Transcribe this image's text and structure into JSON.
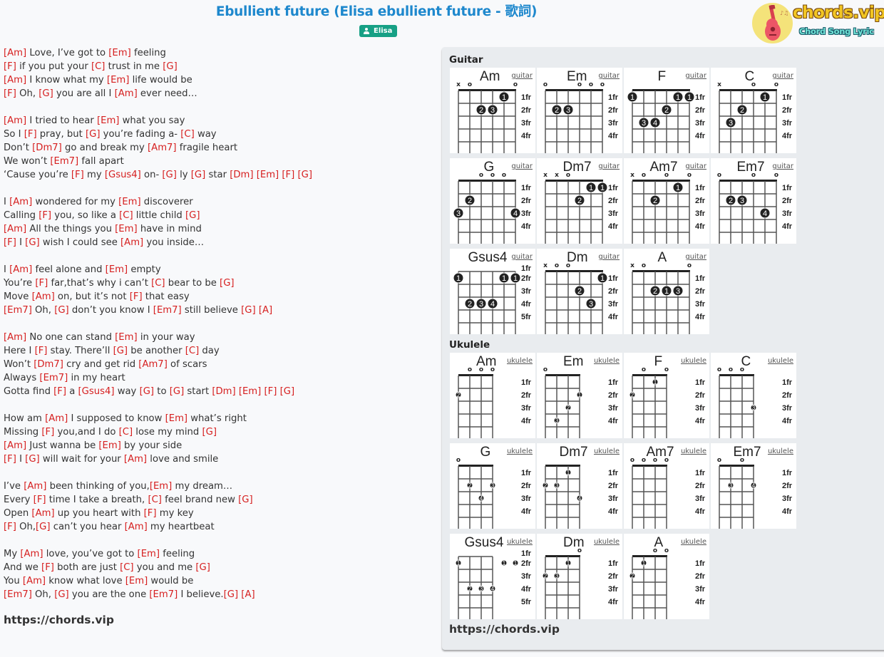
{
  "header": {
    "title": "Ebullient future (Elisa ebullient future - 歌詞)",
    "artist": "Elisa",
    "logo_text": "chords.vip",
    "logo_subtitle": "Chord Song Lyric"
  },
  "lyrics": [
    [
      [
        "Am",
        " Love, I’ve got to "
      ],
      [
        "Em",
        " feeling"
      ]
    ],
    [
      [
        "F",
        " if you put your "
      ],
      [
        "C",
        " trust in me "
      ],
      [
        "G",
        ""
      ]
    ],
    [
      [
        "Am",
        " I know what my "
      ],
      [
        "Em",
        " life would be"
      ]
    ],
    [
      [
        "F",
        " Oh, "
      ],
      [
        "G",
        " you are all I "
      ],
      [
        "Am",
        " ever need…"
      ]
    ],
    null,
    [
      [
        "Am",
        " I tried to hear "
      ],
      [
        "Em",
        " what you say"
      ]
    ],
    [
      [
        null,
        "So I "
      ],
      [
        "F",
        " pray, but "
      ],
      [
        "G",
        " you’re fading a- "
      ],
      [
        "C",
        " way"
      ]
    ],
    [
      [
        null,
        "Don’t "
      ],
      [
        "Dm7",
        " go and break my "
      ],
      [
        "Am7",
        " fragile heart"
      ]
    ],
    [
      [
        null,
        "We won’t "
      ],
      [
        "Em7",
        " fall apart"
      ]
    ],
    [
      [
        null,
        "‘Cause you’re "
      ],
      [
        "F",
        " my "
      ],
      [
        "Gsus4",
        " on- "
      ],
      [
        "G",
        " ly "
      ],
      [
        "G",
        " star "
      ],
      [
        "Dm",
        " "
      ],
      [
        "Em",
        " "
      ],
      [
        "F",
        " "
      ],
      [
        "G",
        ""
      ]
    ],
    null,
    [
      [
        null,
        "I "
      ],
      [
        "Am",
        " wondered for my "
      ],
      [
        "Em",
        " discoverer"
      ]
    ],
    [
      [
        null,
        "Calling "
      ],
      [
        "F",
        " you, so like a "
      ],
      [
        "C",
        " little child "
      ],
      [
        "G",
        ""
      ]
    ],
    [
      [
        "Am",
        " All the things you "
      ],
      [
        "Em",
        " have in mind"
      ]
    ],
    [
      [
        "F",
        " I "
      ],
      [
        "G",
        " wish I could see "
      ],
      [
        "Am",
        " you inside…"
      ]
    ],
    null,
    [
      [
        null,
        "I "
      ],
      [
        "Am",
        " feel alone and "
      ],
      [
        "Em",
        " empty"
      ]
    ],
    [
      [
        null,
        "You’re "
      ],
      [
        "F",
        " far,that’s why i can’t "
      ],
      [
        "C",
        " bear to be "
      ],
      [
        "G",
        ""
      ]
    ],
    [
      [
        null,
        "Move "
      ],
      [
        "Am",
        " on, but it’s not "
      ],
      [
        "F",
        " that easy"
      ]
    ],
    [
      [
        "Em7",
        " Oh, "
      ],
      [
        "G",
        " don’t you know I "
      ],
      [
        "Em7",
        " still believe "
      ],
      [
        "G",
        " "
      ],
      [
        "A",
        ""
      ]
    ],
    null,
    [
      [
        "Am",
        " No one can stand "
      ],
      [
        "Em",
        " in your way"
      ]
    ],
    [
      [
        null,
        "Here I "
      ],
      [
        "F",
        " stay. There’ll "
      ],
      [
        "G",
        " be another "
      ],
      [
        "C",
        " day"
      ]
    ],
    [
      [
        null,
        "Won’t "
      ],
      [
        "Dm7",
        " cry and get rid "
      ],
      [
        "Am7",
        " of scars"
      ]
    ],
    [
      [
        null,
        "Always "
      ],
      [
        "Em7",
        " in my heart"
      ]
    ],
    [
      [
        null,
        "Gotta find "
      ],
      [
        "F",
        " a "
      ],
      [
        "Gsus4",
        " way "
      ],
      [
        "G",
        " to "
      ],
      [
        "G",
        " start "
      ],
      [
        "Dm",
        " "
      ],
      [
        "Em",
        " "
      ],
      [
        "F",
        " "
      ],
      [
        "G",
        ""
      ]
    ],
    null,
    [
      [
        null,
        "How am "
      ],
      [
        "Am",
        " I supposed to know "
      ],
      [
        "Em",
        " what’s right"
      ]
    ],
    [
      [
        null,
        "Missing "
      ],
      [
        "F",
        " you,and I do "
      ],
      [
        "C",
        " lose my mind "
      ],
      [
        "G",
        ""
      ]
    ],
    [
      [
        "Am",
        " Just wanna be "
      ],
      [
        "Em",
        " by your side"
      ]
    ],
    [
      [
        "F",
        " I "
      ],
      [
        "G",
        " will wait for your "
      ],
      [
        "Am",
        " love and smile"
      ]
    ],
    null,
    [
      [
        null,
        "I’ve "
      ],
      [
        "Am",
        " been thinking of you,"
      ],
      [
        "Em",
        " my dream…"
      ]
    ],
    [
      [
        null,
        "Every "
      ],
      [
        "F",
        " time I take a breath, "
      ],
      [
        "C",
        " feel brand new "
      ],
      [
        "G",
        ""
      ]
    ],
    [
      [
        null,
        "Open "
      ],
      [
        "Am",
        " up you heart with "
      ],
      [
        "F",
        " my key"
      ]
    ],
    [
      [
        "F",
        " Oh,"
      ],
      [
        "G",
        " can’t you hear "
      ],
      [
        "Am",
        " my heartbeat"
      ]
    ],
    null,
    [
      [
        null,
        "My "
      ],
      [
        "Am",
        " love, you’ve got to "
      ],
      [
        "Em",
        " feeling"
      ]
    ],
    [
      [
        null,
        "And we "
      ],
      [
        "F",
        " both are just "
      ],
      [
        "C",
        " you and me "
      ],
      [
        "G",
        ""
      ]
    ],
    [
      [
        null,
        "You "
      ],
      [
        "Am",
        " know what love "
      ],
      [
        "Em",
        " would be"
      ]
    ],
    [
      [
        "Em7",
        " Oh, "
      ],
      [
        "G",
        " you are the one "
      ],
      [
        "Em7",
        " I believe."
      ],
      [
        "G",
        " "
      ],
      [
        "A",
        ""
      ]
    ]
  ],
  "footer_url": "https://chords.vip",
  "chord_panel": {
    "guitar_label": "Guitar",
    "ukulele_label": "Ukulele",
    "url": "https://chords.vip",
    "guitar": [
      {
        "name": "Am",
        "link": "guitar",
        "base": 1,
        "markers": [
          "x",
          "o",
          "",
          "",
          "",
          "o"
        ],
        "dots": [
          [
            5,
            1,
            "1"
          ],
          [
            3,
            2,
            "2"
          ],
          [
            4,
            2,
            "3"
          ]
        ]
      },
      {
        "name": "Em",
        "link": "guitar",
        "base": 1,
        "markers": [
          "o",
          "",
          "",
          "o",
          "o",
          "o"
        ],
        "dots": [
          [
            2,
            2,
            "2"
          ],
          [
            3,
            2,
            "3"
          ]
        ]
      },
      {
        "name": "F",
        "link": "guitar",
        "base": 1,
        "markers": [
          "",
          "",
          "",
          "",
          "",
          ""
        ],
        "dots": [
          [
            1,
            1,
            "1"
          ],
          [
            5,
            1,
            "1"
          ],
          [
            6,
            1,
            "1"
          ],
          [
            4,
            2,
            "2"
          ],
          [
            2,
            3,
            "3"
          ],
          [
            3,
            3,
            "4"
          ]
        ]
      },
      {
        "name": "C",
        "link": "guitar",
        "base": 1,
        "markers": [
          "x",
          "",
          "",
          "o",
          "",
          "o"
        ],
        "dots": [
          [
            5,
            1,
            "1"
          ],
          [
            3,
            2,
            "2"
          ],
          [
            2,
            3,
            "3"
          ]
        ]
      },
      {
        "name": "G",
        "link": "guitar",
        "base": 1,
        "markers": [
          "",
          "",
          "o",
          "o",
          "o",
          ""
        ],
        "dots": [
          [
            2,
            2,
            "2"
          ],
          [
            1,
            3,
            "3"
          ],
          [
            6,
            3,
            "4"
          ]
        ]
      },
      {
        "name": "Dm7",
        "link": "guitar",
        "base": 1,
        "markers": [
          "x",
          "x",
          "o",
          "",
          "",
          ""
        ],
        "dots": [
          [
            5,
            1,
            "1"
          ],
          [
            6,
            1,
            "1"
          ],
          [
            4,
            2,
            "2"
          ]
        ]
      },
      {
        "name": "Am7",
        "link": "guitar",
        "base": 1,
        "markers": [
          "x",
          "o",
          "",
          "o",
          "",
          "o"
        ],
        "dots": [
          [
            5,
            1,
            "1"
          ],
          [
            3,
            2,
            "2"
          ]
        ]
      },
      {
        "name": "Em7",
        "link": "guitar",
        "base": 1,
        "markers": [
          "o",
          "",
          "",
          "o",
          "",
          "o"
        ],
        "dots": [
          [
            2,
            2,
            "2"
          ],
          [
            3,
            2,
            "3"
          ],
          [
            5,
            3,
            "4"
          ]
        ]
      },
      {
        "name": "Gsus4",
        "link": "guitar",
        "base": 2,
        "markers": [
          "",
          "",
          "",
          "",
          "",
          ""
        ],
        "dots": [
          [
            1,
            2,
            "1"
          ],
          [
            5,
            2,
            "1"
          ],
          [
            6,
            2,
            "1"
          ],
          [
            2,
            4,
            "2"
          ],
          [
            3,
            4,
            "3"
          ],
          [
            4,
            4,
            "4"
          ]
        ]
      },
      {
        "name": "Dm",
        "link": "guitar",
        "base": 1,
        "markers": [
          "x",
          "o",
          "o",
          "",
          "",
          ""
        ],
        "dots": [
          [
            6,
            1,
            "1"
          ],
          [
            4,
            2,
            "2"
          ],
          [
            5,
            3,
            "3"
          ]
        ]
      },
      {
        "name": "A",
        "link": "guitar",
        "base": 1,
        "markers": [
          "x",
          "o",
          "",
          "",
          "",
          "o"
        ],
        "dots": [
          [
            3,
            2,
            "2"
          ],
          [
            4,
            2,
            "1"
          ],
          [
            5,
            2,
            "3"
          ]
        ]
      }
    ],
    "ukulele": [
      {
        "name": "Am",
        "link": "ukulele",
        "base": 1,
        "markers": [
          "",
          "o",
          "o",
          "o"
        ],
        "dots": [
          [
            1,
            2,
            "2"
          ]
        ]
      },
      {
        "name": "Em",
        "link": "ukulele",
        "base": 1,
        "markers": [
          "o",
          "",
          "",
          ""
        ],
        "dots": [
          [
            4,
            2,
            "1"
          ],
          [
            3,
            3,
            "2"
          ],
          [
            2,
            4,
            "3"
          ]
        ]
      },
      {
        "name": "F",
        "link": "ukulele",
        "base": 1,
        "markers": [
          "",
          "o",
          "",
          "o"
        ],
        "dots": [
          [
            3,
            1,
            "1"
          ],
          [
            1,
            2,
            "2"
          ]
        ]
      },
      {
        "name": "C",
        "link": "ukulele",
        "base": 1,
        "markers": [
          "o",
          "o",
          "o",
          ""
        ],
        "dots": [
          [
            4,
            3,
            "3"
          ]
        ]
      },
      {
        "name": "G",
        "link": "ukulele",
        "base": 1,
        "markers": [
          "o",
          "",
          "",
          ""
        ],
        "dots": [
          [
            2,
            2,
            "2"
          ],
          [
            4,
            2,
            "3"
          ],
          [
            3,
            3,
            "4"
          ]
        ]
      },
      {
        "name": "Dm7",
        "link": "ukulele",
        "base": 1,
        "markers": [
          "",
          "",
          "",
          ""
        ],
        "dots": [
          [
            3,
            1,
            "1"
          ],
          [
            1,
            2,
            "2"
          ],
          [
            2,
            2,
            "3"
          ],
          [
            4,
            3,
            "4"
          ]
        ]
      },
      {
        "name": "Am7",
        "link": "ukulele",
        "base": 1,
        "markers": [
          "o",
          "o",
          "o",
          "o"
        ],
        "dots": []
      },
      {
        "name": "Em7",
        "link": "ukulele",
        "base": 1,
        "markers": [
          "o",
          "",
          "o",
          ""
        ],
        "dots": [
          [
            2,
            2,
            "3"
          ],
          [
            4,
            2,
            "4"
          ]
        ]
      },
      {
        "name": "Gsus4",
        "link": "ukulele",
        "base": 2,
        "markers": [
          "",
          "",
          "",
          ""
        ],
        "dots": [
          [
            1,
            2,
            "1"
          ],
          [
            5,
            2,
            "1"
          ],
          [
            6,
            2,
            "1"
          ],
          [
            2,
            4,
            "2"
          ],
          [
            3,
            4,
            "3"
          ],
          [
            4,
            4,
            "4"
          ]
        ]
      },
      {
        "name": "Dm",
        "link": "ukulele",
        "base": 1,
        "markers": [
          "",
          "",
          "",
          "o"
        ],
        "dots": [
          [
            3,
            1,
            "1"
          ],
          [
            1,
            2,
            "2"
          ],
          [
            2,
            2,
            "3"
          ]
        ]
      },
      {
        "name": "A",
        "link": "ukulele",
        "base": 1,
        "markers": [
          "",
          "",
          "o",
          "o"
        ],
        "dots": [
          [
            2,
            1,
            "1"
          ],
          [
            1,
            2,
            "2"
          ]
        ]
      }
    ]
  }
}
